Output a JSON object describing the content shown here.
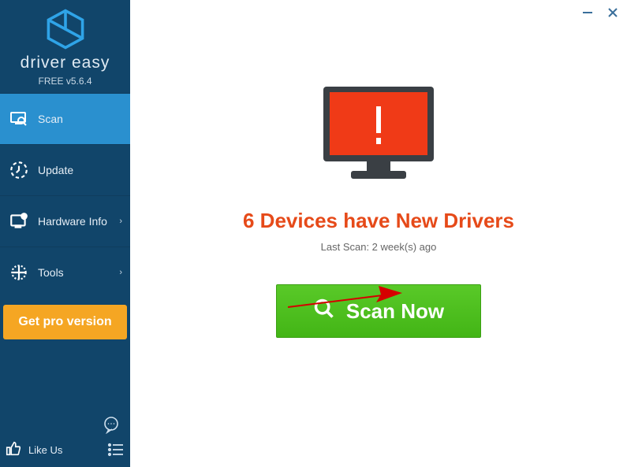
{
  "brand": {
    "name": "driver easy",
    "version": "FREE v5.6.4"
  },
  "nav": {
    "scan": "Scan",
    "update": "Update",
    "hardware": "Hardware Info",
    "tools": "Tools",
    "pro": "Get pro version",
    "likeus": "Like Us"
  },
  "main": {
    "status": "6 Devices have New Drivers",
    "last_scan": "Last Scan: 2 week(s) ago",
    "scan_btn": "Scan Now"
  }
}
